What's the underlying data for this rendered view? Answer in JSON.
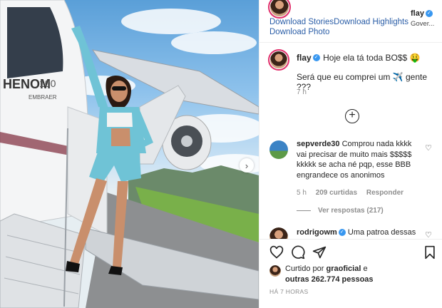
{
  "extension": {
    "download_stories": "Download Stories",
    "download_highlights": "Download Highlights",
    "download_photo": "Download Photo"
  },
  "header": {
    "username": "flay",
    "subtitle": "Gover..."
  },
  "photo": {
    "plane_text_main": "HENOM",
    "plane_text_sub": "EMBRAER",
    "plane_model": "100"
  },
  "caption": {
    "username": "flay",
    "text": "Hoje ela tá toda BO$$ 🤑",
    "question": "Será que eu comprei um ✈️ gente ???",
    "time": "7 h"
  },
  "comment": {
    "username": "sepverde30",
    "text": "Comprou nada kkkk vai precisar de muito mais $$$$$ kkkkk se acha né pqp, esse BBB engrandece os anonimos",
    "time": "5 h",
    "likes": "209 curtidas",
    "reply": "Responder",
    "view_replies": "Ver respostas (217)"
  },
  "comment2": {
    "username": "rodrigowm",
    "text": "Uma patroa dessas"
  },
  "likes_line": {
    "prefix": "Curtido por",
    "user": "graoficial",
    "middle": "e",
    "others": "outras 262.774 pessoas"
  },
  "timestamp": "HÁ 7 HORAS",
  "colors": {
    "link": "#2b5ea7",
    "verified": "#3897f0",
    "story_ring": "#e1306c"
  }
}
